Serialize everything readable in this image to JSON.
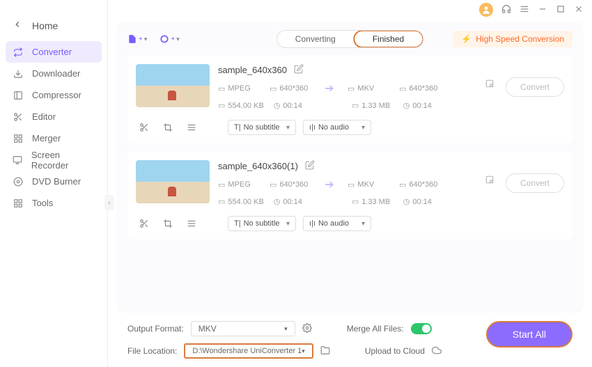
{
  "sidebar": {
    "home": "Home",
    "items": [
      {
        "label": "Converter"
      },
      {
        "label": "Downloader"
      },
      {
        "label": "Compressor"
      },
      {
        "label": "Editor"
      },
      {
        "label": "Merger"
      },
      {
        "label": "Screen Recorder"
      },
      {
        "label": "DVD Burner"
      },
      {
        "label": "Tools"
      }
    ]
  },
  "tabs": {
    "converting": "Converting",
    "finished": "Finished"
  },
  "high_speed": "High Speed Conversion",
  "files": [
    {
      "name": "sample_640x360",
      "src": {
        "format": "MPEG",
        "res": "640*360",
        "size": "554.00 KB",
        "dur": "00:14"
      },
      "dst": {
        "format": "MKV",
        "res": "640*360",
        "size": "1.33 MB",
        "dur": "00:14"
      },
      "subtitle": "No subtitle",
      "audio": "No audio",
      "convert": "Convert"
    },
    {
      "name": "sample_640x360(1)",
      "src": {
        "format": "MPEG",
        "res": "640*360",
        "size": "554.00 KB",
        "dur": "00:14"
      },
      "dst": {
        "format": "MKV",
        "res": "640*360",
        "size": "1.33 MB",
        "dur": "00:14"
      },
      "subtitle": "No subtitle",
      "audio": "No audio",
      "convert": "Convert"
    }
  ],
  "footer": {
    "output_label": "Output Format:",
    "output_value": "MKV",
    "location_label": "File Location:",
    "location_value": "D:\\Wondershare UniConverter 1",
    "merge_label": "Merge All Files:",
    "cloud_label": "Upload to Cloud",
    "start_all": "Start All"
  }
}
